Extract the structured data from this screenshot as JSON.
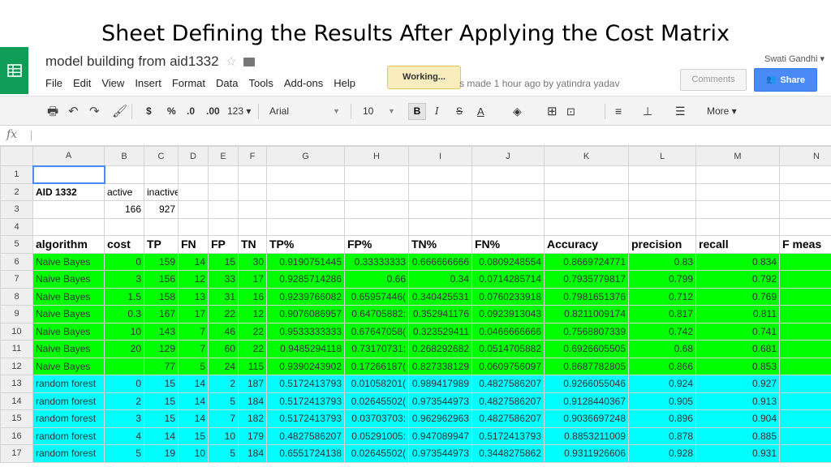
{
  "slide_title": "Sheet Defining the Results After Applying the Cost Matrix",
  "doc": {
    "title": "model building from aid1332",
    "star_icon": "star-icon",
    "folder_icon": "folder-icon"
  },
  "user": "Swati Gandhi ▾",
  "menu": [
    "File",
    "Edit",
    "View",
    "Insert",
    "Format",
    "Data",
    "Tools",
    "Add-ons",
    "Help"
  ],
  "status": {
    "working": "Working...",
    "last_edit": "s made 1 hour ago by yatindra yadav"
  },
  "buttons": {
    "comments": "Comments",
    "share": "Share"
  },
  "toolbar": {
    "currency": "$",
    "percent": "%",
    "dec_less": ".0",
    "dec_more": ".00",
    "format_more": "123 ▾",
    "font": "Arial",
    "font_size": "10",
    "bold": "B",
    "italic": "I",
    "strike": "S",
    "text_color": "A",
    "more": "More ▾"
  },
  "formula": {
    "fx": "fx",
    "value": ""
  },
  "columns": [
    "A",
    "B",
    "C",
    "D",
    "E",
    "F",
    "G",
    "H",
    "I",
    "J",
    "K",
    "L",
    "M",
    "N"
  ],
  "rows": [
    {
      "n": "1",
      "type": "plain",
      "cells": [
        "",
        "",
        "",
        "",
        "",
        "",
        "",
        "",
        "",
        "",
        "",
        "",
        "",
        ""
      ]
    },
    {
      "n": "2",
      "type": "plain",
      "cells": [
        "AID 1332",
        "active",
        "inactive",
        "",
        "",
        "",
        "",
        "",
        "",
        "",
        "",
        "",
        "",
        ""
      ]
    },
    {
      "n": "3",
      "type": "plain",
      "cells": [
        "",
        "166",
        "927",
        "",
        "",
        "",
        "",
        "",
        "",
        "",
        "",
        "",
        "",
        ""
      ]
    },
    {
      "n": "4",
      "type": "plain",
      "cells": [
        "",
        "",
        "",
        "",
        "",
        "",
        "",
        "",
        "",
        "",
        "",
        "",
        "",
        ""
      ]
    },
    {
      "n": "5",
      "type": "hdr",
      "cells": [
        "algorithm",
        "cost",
        "TP",
        "FN",
        "FP",
        "TN",
        "TP%",
        "FP%",
        "TN%",
        "FN%",
        "Accuracy",
        "precision",
        "recall",
        "F meas"
      ]
    },
    {
      "n": "6",
      "type": "nb",
      "cells": [
        "Naive Bayes",
        "0",
        "159",
        "14",
        "15",
        "30",
        "0.9190751445",
        "0.33333333",
        "0.666666666",
        "0.0809248554",
        "0.8669724771",
        "0.83",
        "0.834",
        ""
      ]
    },
    {
      "n": "7",
      "type": "nb",
      "cells": [
        "Naive Bayes",
        "3",
        "156",
        "12",
        "33",
        "17",
        "0.9285714286",
        "0.66",
        "0.34",
        "0.0714285714",
        "0.7935779817",
        "0.799",
        "0.792",
        ""
      ]
    },
    {
      "n": "8",
      "type": "nb",
      "cells": [
        "Naive Bayes",
        "1.5",
        "158",
        "13",
        "31",
        "16",
        "0.9239766082",
        "0.65957446(",
        "0.340425531",
        "0.0760233918",
        "0.7981651376",
        "0.712",
        "0.769",
        ""
      ]
    },
    {
      "n": "9",
      "type": "nb",
      "cells": [
        "Naive Bayes",
        "0.3",
        "167",
        "17",
        "22",
        "12",
        "0.9076086957",
        "0.64705882:",
        "0.352941176",
        "0.0923913043",
        "0.8211009174",
        "0.817",
        "0.811",
        ""
      ]
    },
    {
      "n": "10",
      "type": "nb",
      "cells": [
        "Naive Bayes",
        "10",
        "143",
        "7",
        "46",
        "22",
        "0.9533333333",
        "0.67647058(",
        "0.323529411",
        "0.0466666666",
        "0.7568807339",
        "0.742",
        "0.741",
        ""
      ]
    },
    {
      "n": "11",
      "type": "nb",
      "cells": [
        "Naive Bayes",
        "20",
        "129",
        "7",
        "60",
        "22",
        "0.9485294118",
        "0.73170731:",
        "0.268292682",
        "0.0514705882",
        "0.6926605505",
        "0.68",
        "0.681",
        ""
      ]
    },
    {
      "n": "12",
      "type": "nb",
      "cells": [
        "Naive Bayes",
        "",
        "77",
        "5",
        "24",
        "115",
        "0.9390243902",
        "0.17266187(",
        "0.827338129",
        "0.0609756097",
        "0.8687782805",
        "0.866",
        "0.853",
        ""
      ]
    },
    {
      "n": "13",
      "type": "rf",
      "cells": [
        "random forest",
        "0",
        "15",
        "14",
        "2",
        "187",
        "0.5172413793",
        "0.01058201(",
        "0.989417989",
        "0.4827586207",
        "0.9266055046",
        "0.924",
        "0.927",
        ""
      ]
    },
    {
      "n": "14",
      "type": "rf",
      "cells": [
        "random forest",
        "2",
        "15",
        "14",
        "5",
        "184",
        "0.5172413793",
        "0.02645502(",
        "0.973544973",
        "0.4827586207",
        "0.9128440367",
        "0.905",
        "0.913",
        ""
      ]
    },
    {
      "n": "15",
      "type": "rf",
      "cells": [
        "random forest",
        "3",
        "15",
        "14",
        "7",
        "182",
        "0.5172413793",
        "0.03703703:",
        "0.962962963",
        "0.4827586207",
        "0.9036697248",
        "0.896",
        "0.904",
        ""
      ]
    },
    {
      "n": "16",
      "type": "rf",
      "cells": [
        "random forest",
        "4",
        "14",
        "15",
        "10",
        "179",
        "0.4827586207",
        "0.05291005:",
        "0.947089947",
        "0.5172413793",
        "0.8853211009",
        "0.878",
        "0.885",
        ""
      ]
    },
    {
      "n": "17",
      "type": "rf",
      "cells": [
        "random forest",
        "5",
        "19",
        "10",
        "5",
        "184",
        "0.6551724138",
        "0.02645502(",
        "0.973544973",
        "0.3448275862",
        "0.9311926606",
        "0.928",
        "0.931",
        ""
      ]
    }
  ]
}
